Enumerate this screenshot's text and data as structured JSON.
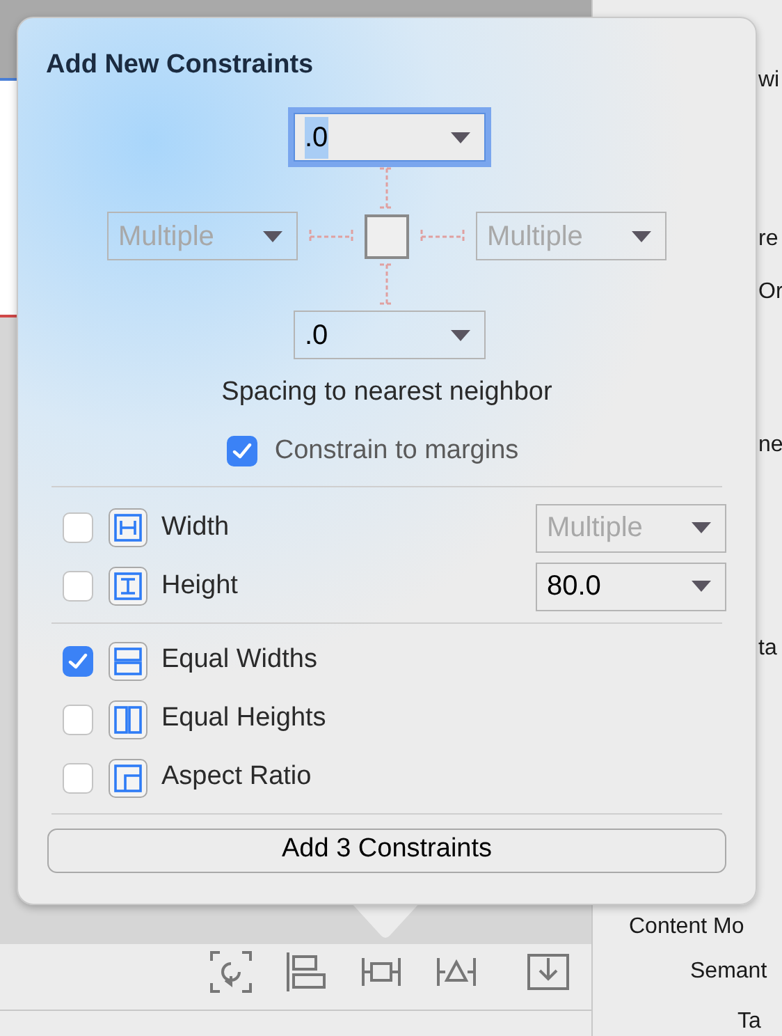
{
  "inspector_labels": [
    "wi",
    "re",
    "Or",
    "ne",
    "ta",
    "Content Mo",
    "Semant",
    "Ta"
  ],
  "popover": {
    "title": "Add New Constraints",
    "spacing": {
      "top": {
        "value": ".0",
        "focused": true,
        "disabled": false
      },
      "left": {
        "value": "Multiple",
        "focused": false,
        "disabled": true
      },
      "right": {
        "value": "Multiple",
        "focused": false,
        "disabled": true
      },
      "bottom": {
        "value": ".0",
        "focused": false,
        "disabled": false
      }
    },
    "caption": "Spacing to nearest neighbor",
    "constrain_to_margins": {
      "label": "Constrain to margins",
      "checked": true
    },
    "size_rows": [
      {
        "kind": "width",
        "label": "Width",
        "checked": false,
        "dropdown": {
          "value": "Multiple",
          "disabled": true
        }
      },
      {
        "kind": "height",
        "label": "Height",
        "checked": false,
        "dropdown": {
          "value": "80.0",
          "disabled": false
        }
      }
    ],
    "equal_rows": [
      {
        "kind": "equal-widths",
        "label": "Equal Widths",
        "checked": true
      },
      {
        "kind": "equal-heights",
        "label": "Equal Heights",
        "checked": false
      },
      {
        "kind": "aspect-ratio",
        "label": "Aspect Ratio",
        "checked": false
      }
    ],
    "add_button": "Add 3 Constraints"
  }
}
